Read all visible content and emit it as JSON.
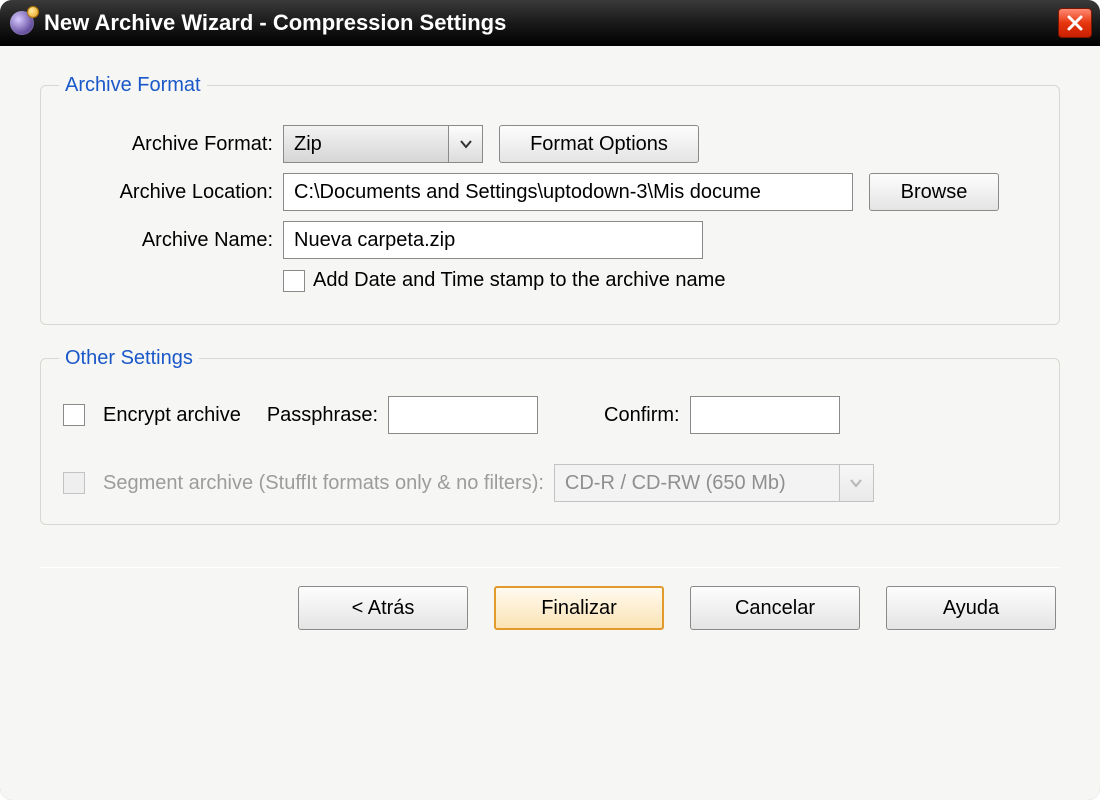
{
  "window": {
    "title": "New Archive Wizard - Compression Settings"
  },
  "group_archive": {
    "legend": "Archive Format",
    "format_label": "Archive Format:",
    "format_value": "Zip",
    "format_options_btn": "Format Options",
    "location_label": "Archive Location:",
    "location_value": "C:\\Documents and Settings\\uptodown-3\\Mis docume",
    "browse_btn": "Browse",
    "name_label": "Archive Name:",
    "name_value": "Nueva carpeta.zip",
    "datestamp_label": "Add Date and Time stamp to the archive name",
    "datestamp_checked": false
  },
  "group_other": {
    "legend": "Other Settings",
    "encrypt_label": "Encrypt archive",
    "encrypt_checked": false,
    "passphrase_label": "Passphrase:",
    "passphrase_value": "",
    "confirm_label": "Confirm:",
    "confirm_value": "",
    "segment_label": "Segment archive (StuffIt formats only & no filters):",
    "segment_enabled": false,
    "segment_value": "CD-R / CD-RW (650 Mb)"
  },
  "footer": {
    "back": "< Atrás",
    "finish": "Finalizar",
    "cancel": "Cancelar",
    "help": "Ayuda"
  }
}
